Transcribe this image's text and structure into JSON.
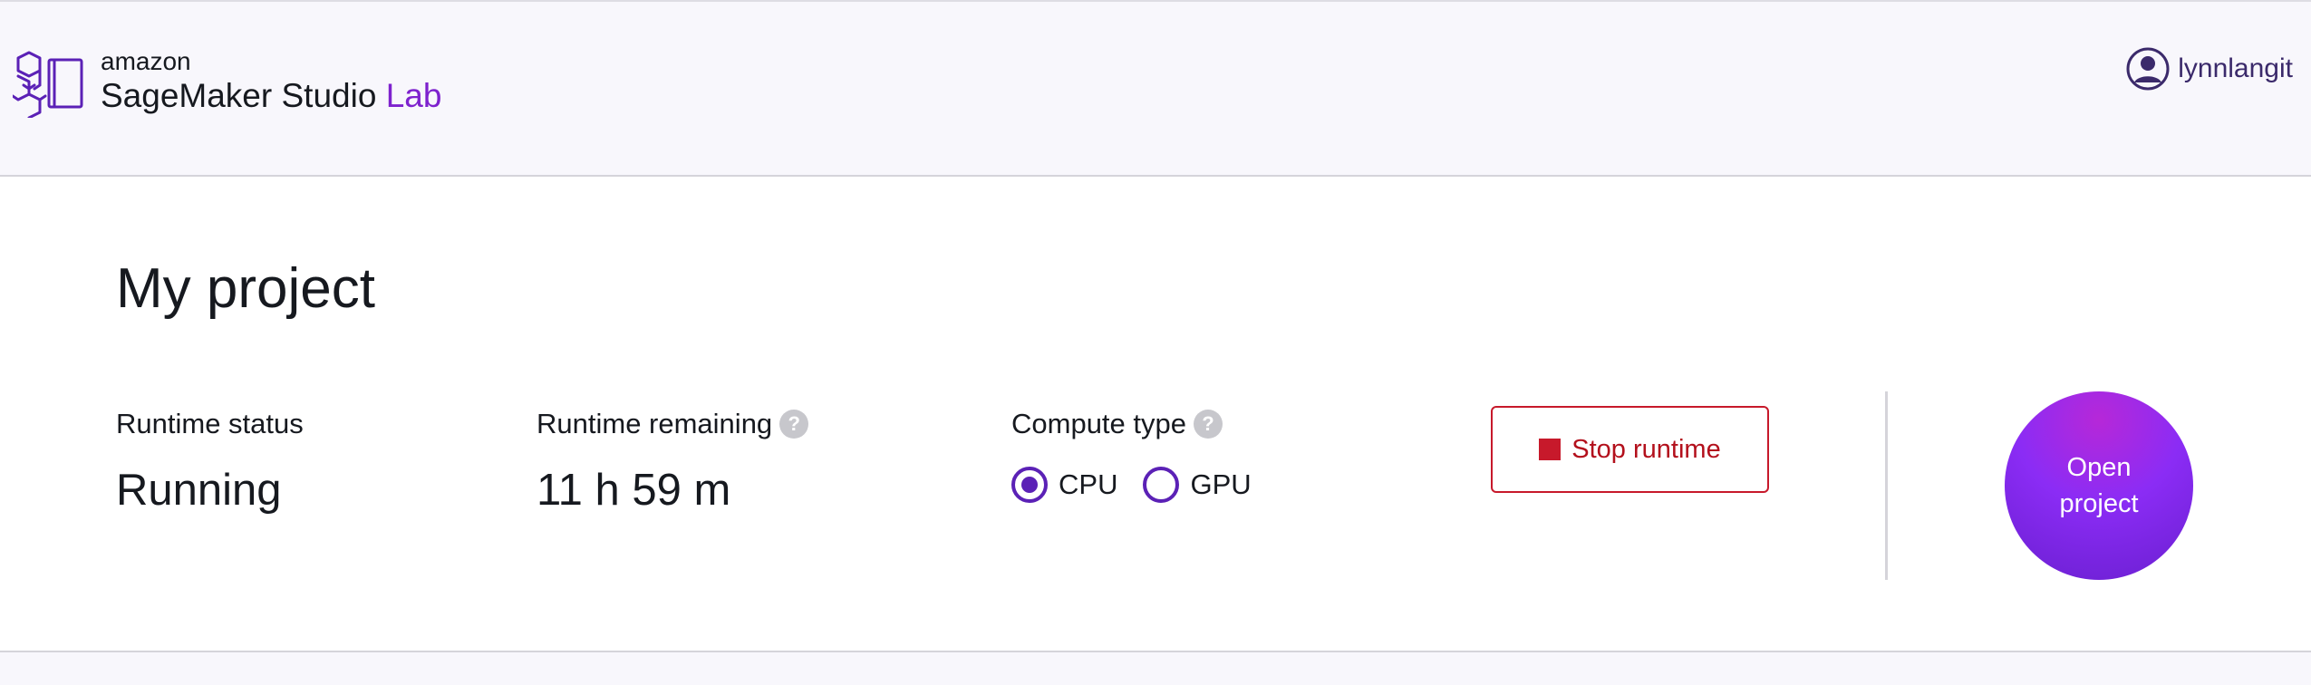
{
  "header": {
    "brand_small": "amazon",
    "brand_main": "SageMaker Studio",
    "brand_accent": "Lab",
    "logo_icon": "sagemaker-logo-icon",
    "user": {
      "icon": "user-avatar-icon",
      "name": "lynnlangit"
    }
  },
  "project": {
    "title": "My project",
    "runtime_status": {
      "label": "Runtime status",
      "value": "Running"
    },
    "runtime_remaining": {
      "label": "Runtime remaining",
      "help_icon": "?",
      "value": "11 h 59 m"
    },
    "compute_type": {
      "label": "Compute type",
      "help_icon": "?",
      "options": [
        {
          "label": "CPU",
          "selected": true
        },
        {
          "label": "GPU",
          "selected": false
        }
      ]
    },
    "stop_button": {
      "label": "Stop runtime",
      "icon": "stop-square-icon"
    },
    "open_button": {
      "label": "Open project"
    }
  },
  "colors": {
    "accent": "#7e22ce",
    "radio": "#5b21b6",
    "danger": "#c7192b",
    "open_button": "#8b2cf5"
  }
}
